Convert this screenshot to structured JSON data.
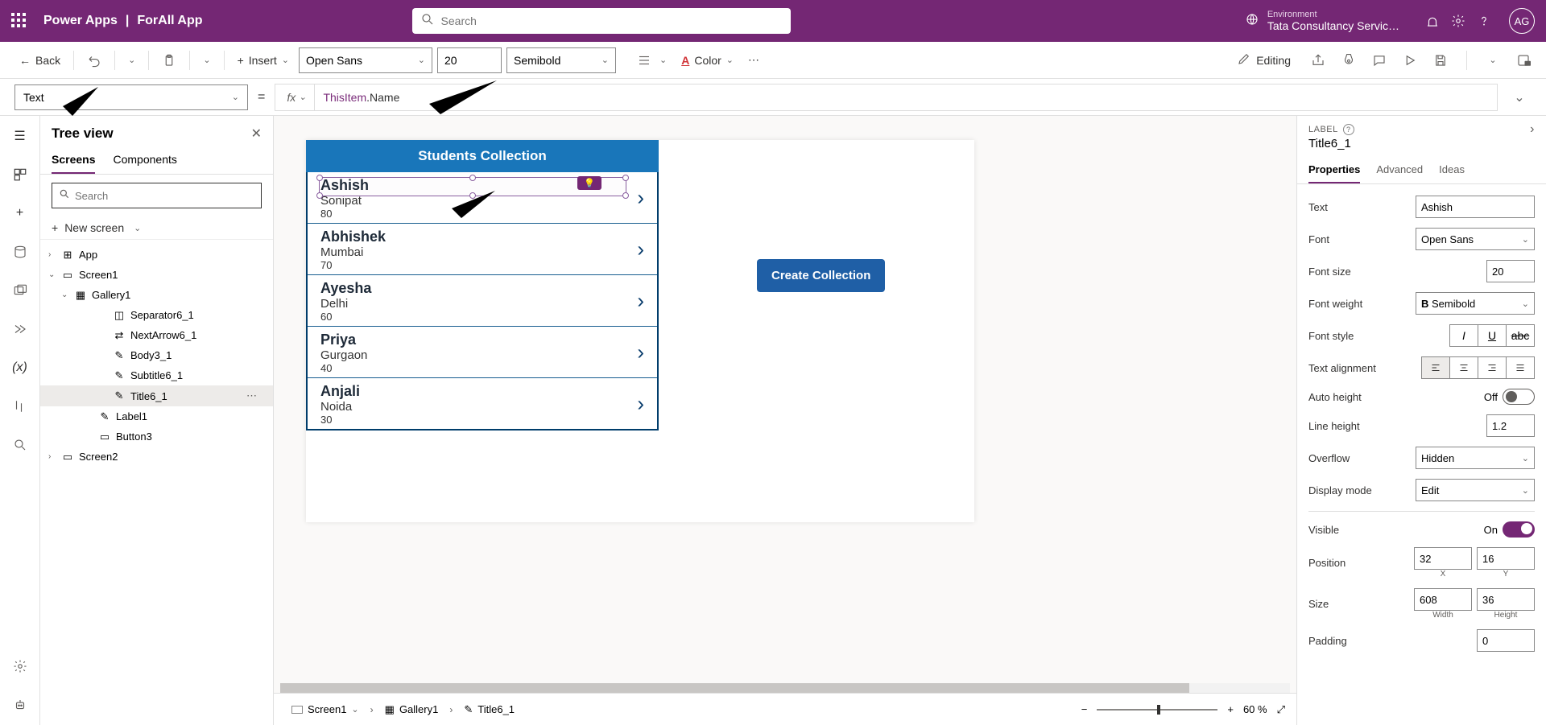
{
  "header": {
    "brand": "Power Apps",
    "separator": "|",
    "app_name": "ForAll App",
    "search_placeholder": "Search",
    "environment_label": "Environment",
    "environment_name": "Tata Consultancy Servic…",
    "avatar": "AG"
  },
  "toolbar": {
    "back": "Back",
    "insert": "Insert",
    "font_family": "Open Sans",
    "font_size": "20",
    "font_weight": "Semibold",
    "color": "Color",
    "editing": "Editing"
  },
  "formula": {
    "property": "Text",
    "fx": "fx",
    "value_tok1": "ThisItem",
    "value_tok2": ".Name"
  },
  "tree": {
    "title": "Tree view",
    "tab_screens": "Screens",
    "tab_components": "Components",
    "search_placeholder": "Search",
    "new_screen": "New screen",
    "items": [
      {
        "indent": 0,
        "caret": "›",
        "icon": "⊞",
        "label": "App"
      },
      {
        "indent": 0,
        "caret": "⌄",
        "icon": "▭",
        "label": "Screen1"
      },
      {
        "indent": 1,
        "caret": "⌄",
        "icon": "▦",
        "label": "Gallery1"
      },
      {
        "indent": 3,
        "caret": "",
        "icon": "◫",
        "label": "Separator6_1"
      },
      {
        "indent": 3,
        "caret": "",
        "icon": "⇄",
        "label": "NextArrow6_1"
      },
      {
        "indent": 3,
        "caret": "",
        "icon": "✎",
        "label": "Body3_1"
      },
      {
        "indent": 3,
        "caret": "",
        "icon": "✎",
        "label": "Subtitle6_1"
      },
      {
        "indent": 3,
        "caret": "",
        "icon": "✎",
        "label": "Title6_1",
        "selected": true
      },
      {
        "indent": "3b",
        "caret": "",
        "icon": "✎",
        "label": "Label1"
      },
      {
        "indent": "3b",
        "caret": "",
        "icon": "▭",
        "label": "Button3"
      },
      {
        "indent": 0,
        "caret": "›",
        "icon": "▭",
        "label": "Screen2"
      }
    ]
  },
  "canvas": {
    "header": "Students Collection",
    "button": "Create Collection",
    "rows": [
      {
        "name": "Ashish",
        "city": "Sonipat",
        "marks": "80"
      },
      {
        "name": "Abhishek",
        "city": "Mumbai",
        "marks": "70"
      },
      {
        "name": "Ayesha",
        "city": "Delhi",
        "marks": "60"
      },
      {
        "name": "Priya",
        "city": "Gurgaon",
        "marks": "40"
      },
      {
        "name": "Anjali",
        "city": "Noida",
        "marks": "30"
      }
    ]
  },
  "breadcrumb": {
    "item1": "Screen1",
    "item2": "Gallery1",
    "item3": "Title6_1",
    "zoom_pct": "60 %"
  },
  "props": {
    "type": "LABEL",
    "name": "Title6_1",
    "tab_properties": "Properties",
    "tab_advanced": "Advanced",
    "tab_ideas": "Ideas",
    "text_label": "Text",
    "text_value": "Ashish",
    "font_label": "Font",
    "font_value": "Open Sans",
    "fontsize_label": "Font size",
    "fontsize_value": "20",
    "fontweight_label": "Font weight",
    "fontweight_value": "Semibold",
    "fontstyle_label": "Font style",
    "align_label": "Text alignment",
    "autoheight_label": "Auto height",
    "autoheight_state": "Off",
    "lineheight_label": "Line height",
    "lineheight_value": "1.2",
    "overflow_label": "Overflow",
    "overflow_value": "Hidden",
    "displaymode_label": "Display mode",
    "displaymode_value": "Edit",
    "visible_label": "Visible",
    "visible_state": "On",
    "position_label": "Position",
    "pos_x": "32",
    "pos_y": "16",
    "pos_xlbl": "X",
    "pos_ylbl": "Y",
    "size_label": "Size",
    "size_w": "608",
    "size_h": "36",
    "size_wlbl": "Width",
    "size_hlbl": "Height",
    "padding_label": "Padding",
    "pad_v": "0"
  }
}
